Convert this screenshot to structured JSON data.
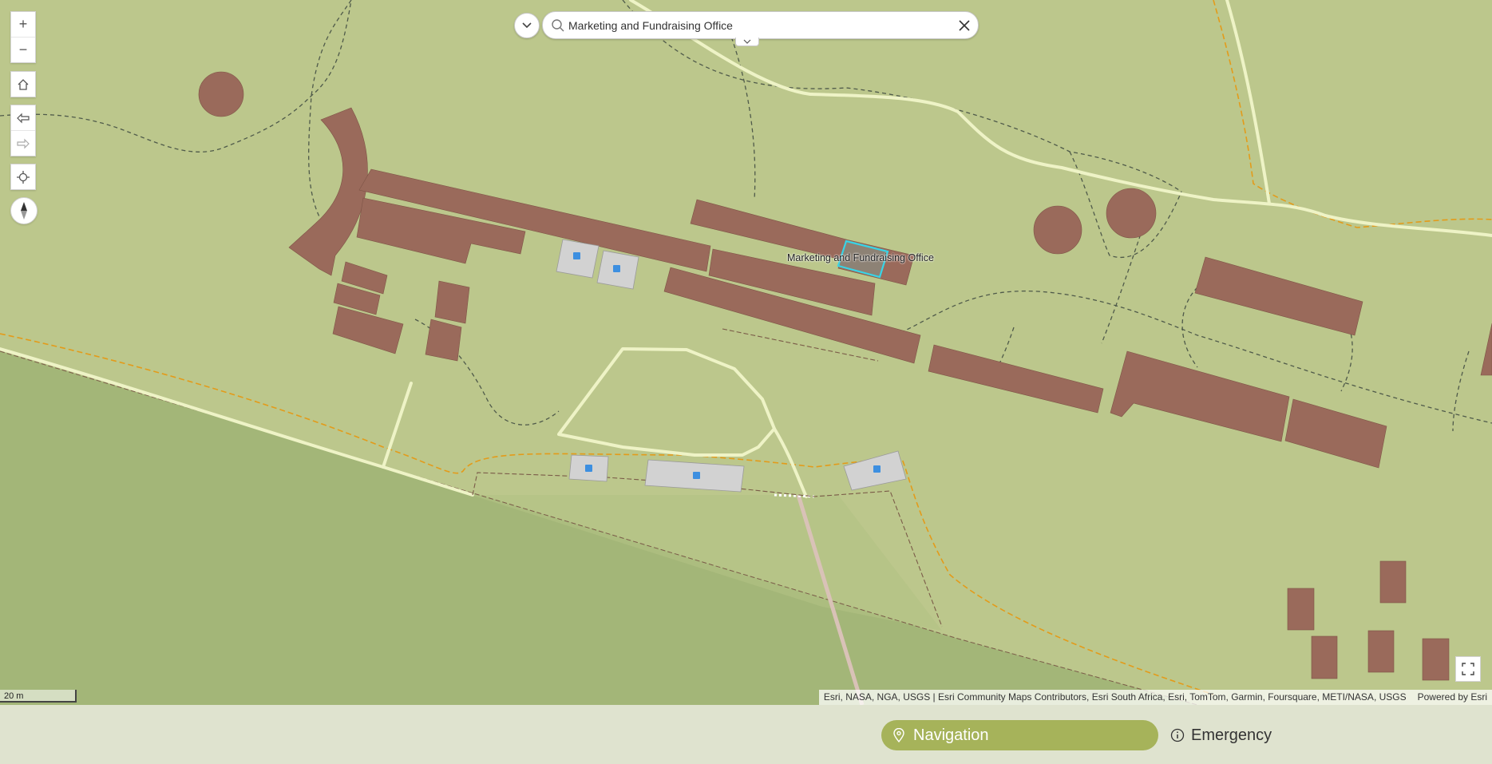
{
  "search": {
    "query": "Marketing and Fundraising Office"
  },
  "map": {
    "selected_label": "Marketing and Fundraising Office",
    "scale_label": "20 m",
    "attribution": "Esri, NASA, NGA, USGS | Esri Community Maps Contributors, Esri South Africa, Esri, TomTom, Garmin, Foursquare, METI/NASA, USGS",
    "powered_by": "Powered by Esri",
    "colors": {
      "ground": "#bcc78c",
      "lower_ground": "#a0b577",
      "building": "#9a6a5b",
      "highlight": "#38d4e6",
      "path": "#eef3c6",
      "boundary": "#e39b1a",
      "parking": "#d2d2d2"
    }
  },
  "controls": {
    "zoom_in": "+",
    "zoom_out": "−"
  },
  "bottom_bar": {
    "navigation_label": "Navigation",
    "emergency_label": "Emergency",
    "accent": "#a6b35a"
  }
}
